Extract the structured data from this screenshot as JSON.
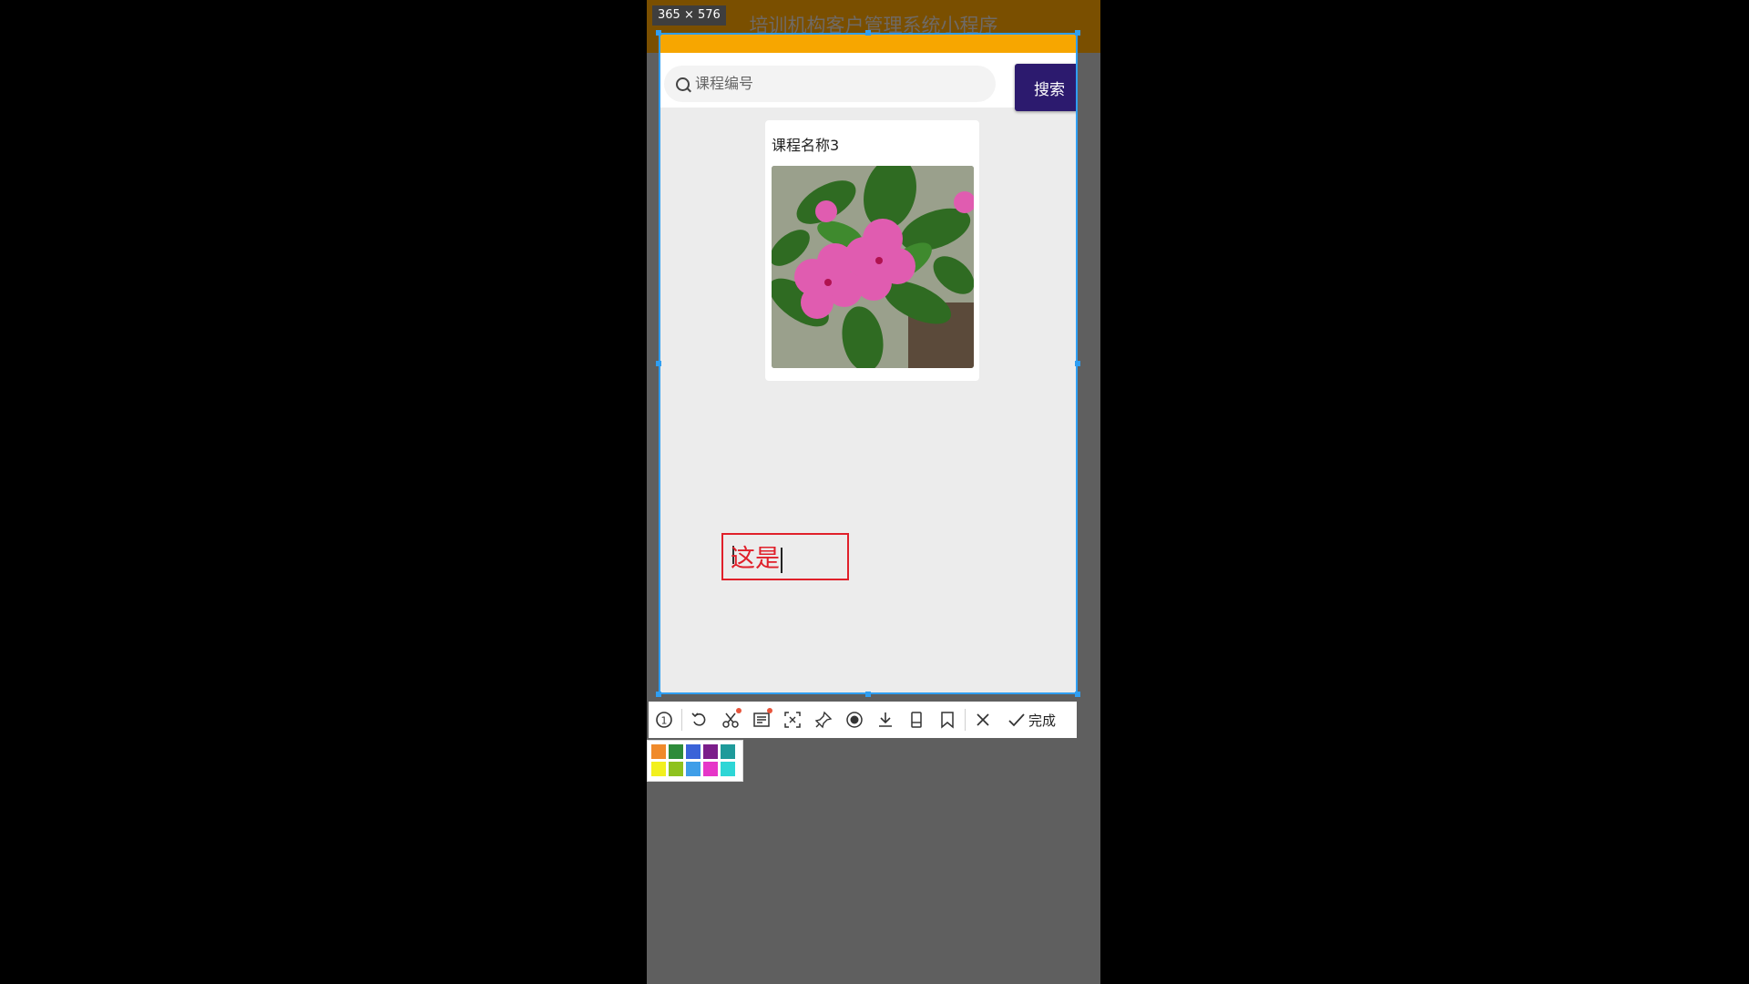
{
  "app": {
    "title": "培训机构客户管理系统小程序",
    "selection_size": "365 × 576"
  },
  "search": {
    "placeholder": "课程编号",
    "button_label": "搜索"
  },
  "course_card": {
    "title": "课程名称3",
    "image_icon": "pink-periwinkle-flower-photo"
  },
  "annotation": {
    "text": "这是",
    "color": "#e0202a"
  },
  "toolbar": {
    "tools": [
      {
        "icon": "step-number-icon"
      },
      {
        "icon": "undo-icon"
      },
      {
        "icon": "scissors-icon"
      },
      {
        "icon": "ocr-text-icon"
      },
      {
        "icon": "fullscreen-select-icon"
      },
      {
        "icon": "pin-icon"
      },
      {
        "icon": "record-icon"
      },
      {
        "icon": "download-icon"
      },
      {
        "icon": "long-screenshot-icon"
      },
      {
        "icon": "bookmark-icon"
      },
      {
        "icon": "close-icon"
      }
    ],
    "done_label": "完成"
  },
  "palette": {
    "colors": [
      "#f08a2b",
      "#2e8b3a",
      "#3b63d8",
      "#7b1e8a",
      "#1e9a9a",
      "#f2f01e",
      "#8ec21e",
      "#3f9ee8",
      "#e636c8",
      "#2ed6d6"
    ]
  },
  "theme": {
    "header_color": "#f7a600",
    "button_color": "#2c1a6e",
    "selection_color": "#2f9ef2"
  }
}
